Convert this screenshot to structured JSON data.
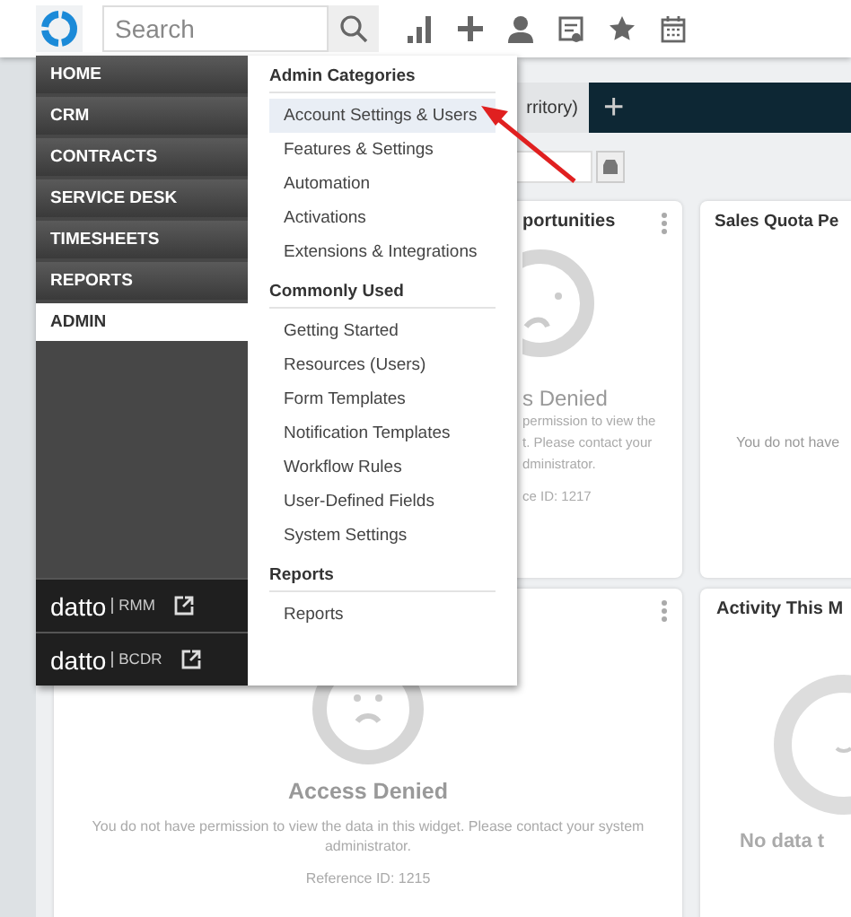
{
  "topbar": {
    "search": {
      "placeholder": "Search"
    }
  },
  "tabs": [
    {
      "label": "rritory)",
      "kind": "tab"
    },
    {
      "label": "+",
      "kind": "add"
    }
  ],
  "cards": [
    {
      "kind": "denied_partial",
      "title": "portunities",
      "heading": "s Denied",
      "lines": [
        "permission to view the",
        "t. Please contact your",
        "dministrator."
      ],
      "reference": "ce ID: 1217"
    },
    {
      "kind": "empty",
      "title": "Sales Quota Pe",
      "message": "You do not have"
    },
    {
      "kind": "denied",
      "heading": "Access Denied",
      "message": "You do not have permission to view the data in this widget. Please contact your system administrator.",
      "reference": "Reference ID: 1215"
    },
    {
      "kind": "nodata",
      "title": "Activity This M",
      "message": "No data t"
    }
  ],
  "nav": {
    "items": [
      {
        "label": "HOME",
        "selected": false
      },
      {
        "label": "CRM",
        "selected": false
      },
      {
        "label": "CONTRACTS",
        "selected": false
      },
      {
        "label": "SERVICE DESK",
        "selected": false
      },
      {
        "label": "TIMESHEETS",
        "selected": false
      },
      {
        "label": "REPORTS",
        "selected": false
      },
      {
        "label": "ADMIN",
        "selected": true
      }
    ],
    "links": [
      {
        "brand": "datto",
        "product": "RMM"
      },
      {
        "brand": "datto",
        "product": "BCDR"
      }
    ]
  },
  "admin_menu": {
    "sections": [
      {
        "heading": "Admin Categories",
        "items": [
          {
            "label": "Account Settings & Users",
            "selected": true
          },
          {
            "label": "Features & Settings",
            "selected": false
          },
          {
            "label": "Automation",
            "selected": false
          },
          {
            "label": "Activations",
            "selected": false
          },
          {
            "label": "Extensions & Integrations",
            "selected": false
          }
        ]
      },
      {
        "heading": "Commonly Used",
        "items": [
          {
            "label": "Getting Started",
            "selected": false
          },
          {
            "label": "Resources (Users)",
            "selected": false
          },
          {
            "label": "Form Templates",
            "selected": false
          },
          {
            "label": "Notification Templates",
            "selected": false
          },
          {
            "label": "Workflow Rules",
            "selected": false
          },
          {
            "label": "User-Defined Fields",
            "selected": false
          },
          {
            "label": "System Settings",
            "selected": false
          }
        ]
      },
      {
        "heading": "Reports",
        "items": [
          {
            "label": "Reports",
            "selected": false
          }
        ]
      }
    ]
  }
}
